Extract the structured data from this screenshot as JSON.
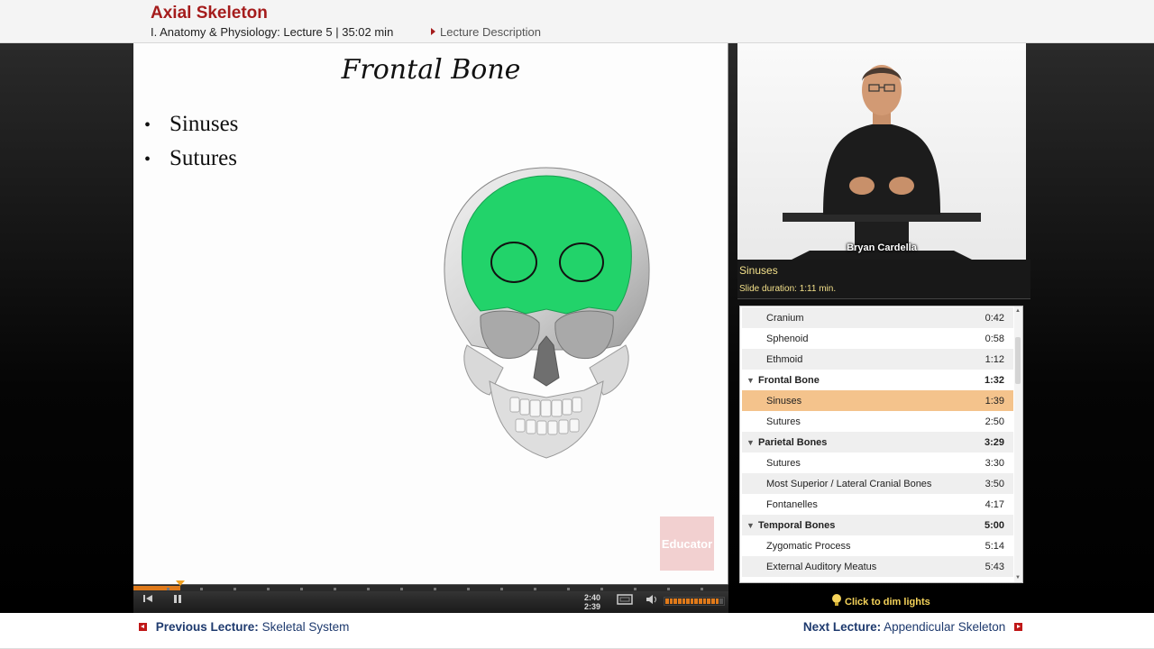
{
  "header": {
    "title": "Axial Skeleton",
    "meta": "I. Anatomy & Physiology: Lecture 5 | 35:02 min",
    "description_link": "Lecture Description"
  },
  "slide": {
    "title": "Frontal Bone",
    "bullets": [
      "Sinuses",
      "Sutures"
    ],
    "logo_text": "Educator"
  },
  "player": {
    "progress": 0.079,
    "elapsed": "2:40",
    "remaining": "2:39",
    "volume_level": 0.9
  },
  "video": {
    "presenter_name": "Bryan Cardella"
  },
  "slide_info": {
    "current": "Sinuses",
    "duration": "Slide duration: 1:11 min."
  },
  "toc": [
    {
      "label": "Cranium",
      "time": "0:42",
      "type": "item"
    },
    {
      "label": "Sphenoid",
      "time": "0:58",
      "type": "item"
    },
    {
      "label": "Ethmoid",
      "time": "1:12",
      "type": "item"
    },
    {
      "label": "Frontal Bone",
      "time": "1:32",
      "type": "section"
    },
    {
      "label": "Sinuses",
      "time": "1:39",
      "type": "item",
      "active": true
    },
    {
      "label": "Sutures",
      "time": "2:50",
      "type": "item"
    },
    {
      "label": "Parietal Bones",
      "time": "3:29",
      "type": "section"
    },
    {
      "label": "Sutures",
      "time": "3:30",
      "type": "item"
    },
    {
      "label": "Most Superior / Lateral Cranial Bones",
      "time": "3:50",
      "type": "item"
    },
    {
      "label": "Fontanelles",
      "time": "4:17",
      "type": "item"
    },
    {
      "label": "Temporal Bones",
      "time": "5:00",
      "type": "section"
    },
    {
      "label": "Zygomatic Process",
      "time": "5:14",
      "type": "item"
    },
    {
      "label": "External Auditory Meatus",
      "time": "5:43",
      "type": "item"
    }
  ],
  "dim_lights": "Click to dim lights",
  "footer": {
    "prev_prefix": "Previous Lecture:",
    "prev_title": "Skeletal System",
    "next_prefix": "Next Lecture:",
    "next_title": "Appendicular Skeleton"
  },
  "colors": {
    "title_red": "#a51c1c",
    "highlight_green": "#22d36a",
    "active_row": "#f4c38c",
    "accent_orange": "#e07a1a"
  }
}
